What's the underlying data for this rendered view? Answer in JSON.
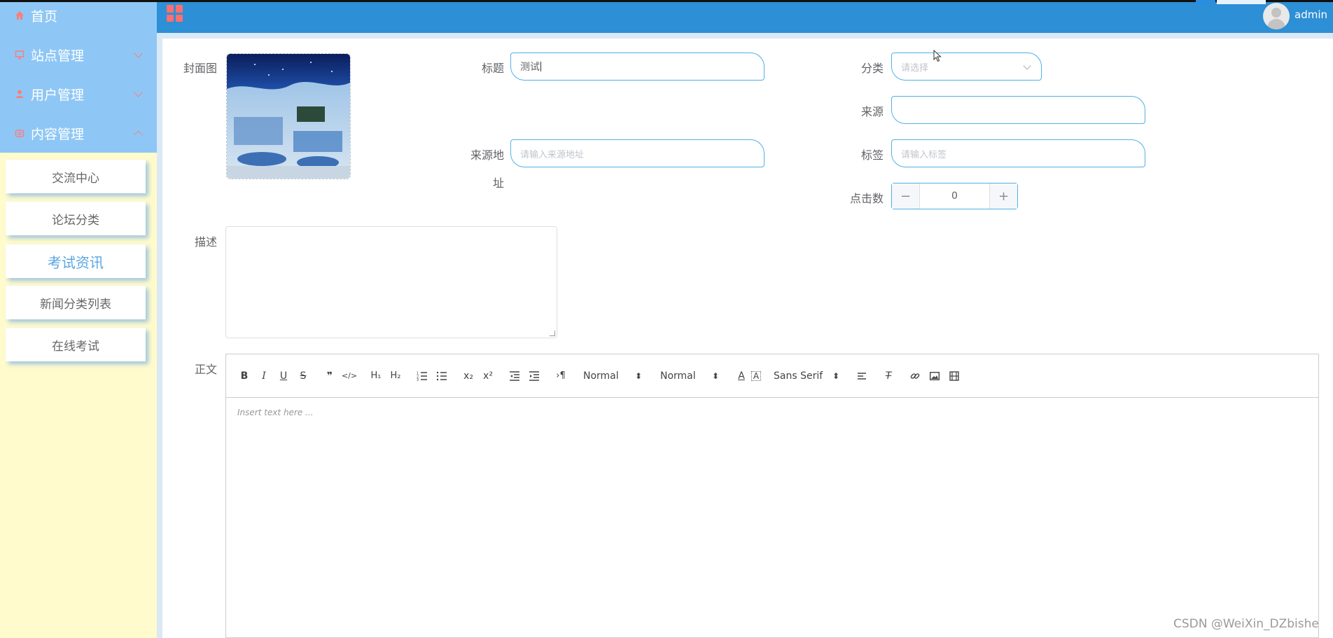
{
  "sidebar": {
    "menu": [
      {
        "label": "首页",
        "icon": "home-icon"
      },
      {
        "label": "站点管理",
        "icon": "monitor-icon"
      },
      {
        "label": "用户管理",
        "icon": "user-icon"
      },
      {
        "label": "内容管理",
        "icon": "content-icon"
      }
    ],
    "submenu": [
      {
        "label": "交流中心"
      },
      {
        "label": "论坛分类"
      },
      {
        "label": "考试资讯",
        "active": true
      },
      {
        "label": "新闻分类列表"
      },
      {
        "label": "在线考试"
      }
    ]
  },
  "header": {
    "menu_icon": "grid-icon",
    "username": "admin"
  },
  "form": {
    "cover_label": "封面图",
    "title_label": "标题",
    "title_value": "测试",
    "category_label": "分类",
    "category_placeholder": "请选择",
    "source_label": "来源",
    "source_value": "",
    "source_url_label_1": "来源地",
    "source_url_label_2": "址",
    "source_url_placeholder": "请输入来源地址",
    "tags_label": "标签",
    "tags_placeholder": "请输入标签",
    "clicks_label": "点击数",
    "clicks_value": "0",
    "clicks_minus": "−",
    "clicks_plus": "+",
    "description_label": "描述",
    "body_label": "正文"
  },
  "editor": {
    "header_picker": "Normal",
    "size_picker": "Normal",
    "font_picker": "Sans Serif",
    "placeholder": "Insert text here ..."
  },
  "watermark": "CSDN @WeiXin_DZbishe",
  "colors": {
    "header": "#2d8fd5",
    "sidebar_menu": "#8ec7f5",
    "sidebar_bg": "#fffbcc",
    "accent_input_border": "#4fb0e8",
    "icon_red": "#ff7c7c"
  }
}
